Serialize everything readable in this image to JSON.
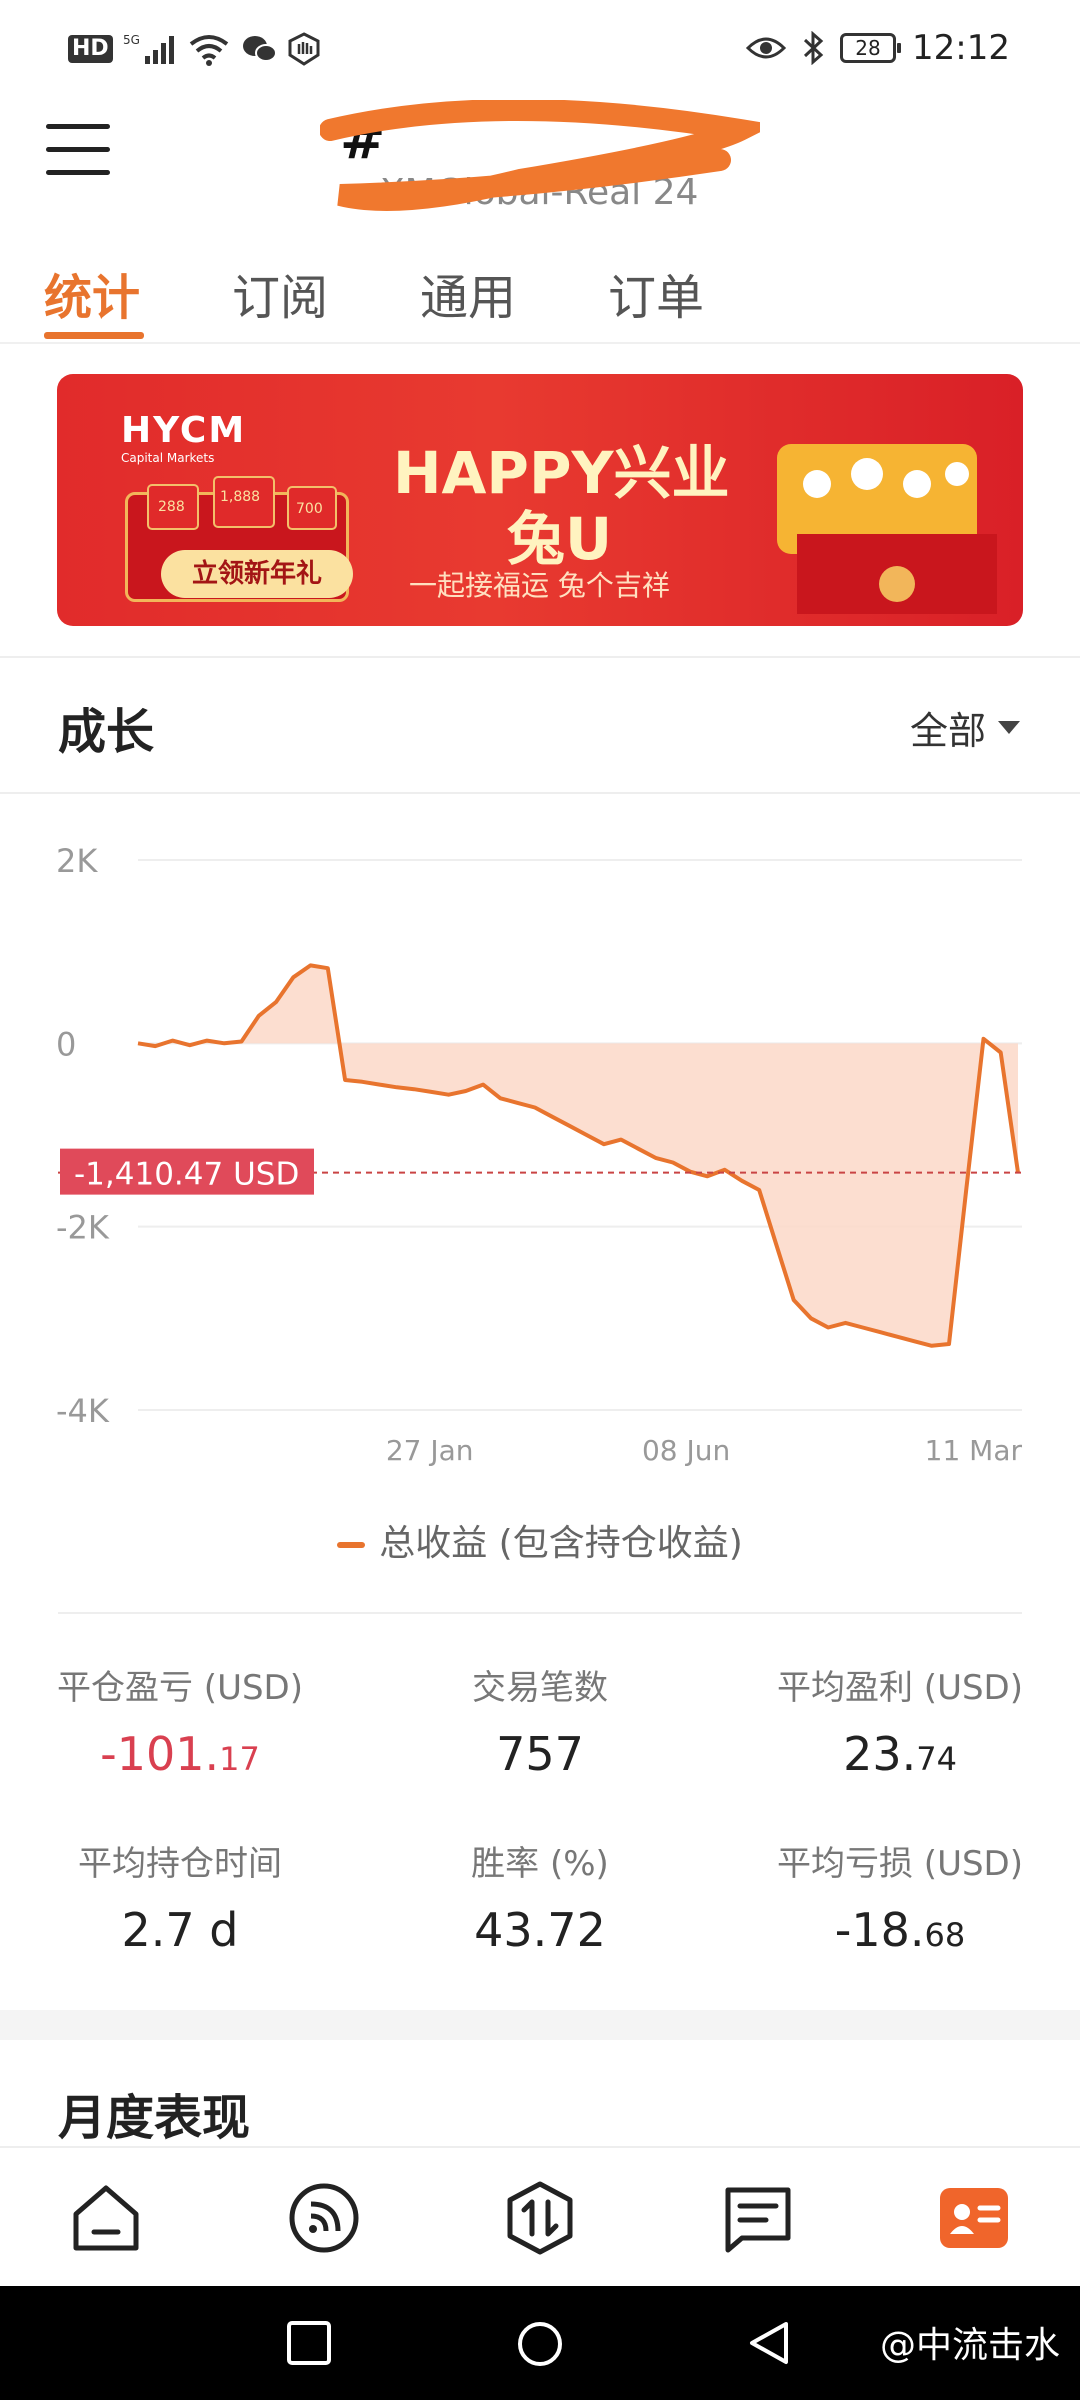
{
  "status_bar": {
    "left_badge": "HD",
    "signal_label": "5G",
    "wifi_label": "6",
    "battery": "28",
    "time": "12:12"
  },
  "header": {
    "title": "#",
    "subtitle": "XMGlobal-Real 24"
  },
  "tabs": [
    {
      "label": "统计",
      "active": true
    },
    {
      "label": "订阅",
      "active": false
    },
    {
      "label": "通用",
      "active": false
    },
    {
      "label": "订单",
      "active": false
    }
  ],
  "banner": {
    "logo": "HYCM",
    "logo_sub": "Capital Markets",
    "red_packet_amounts": [
      "288",
      "1,888",
      "700"
    ],
    "button_label": "立领新年礼",
    "headline": "HAPPY兴业",
    "headline2": "兔U",
    "slogan": "一起接福运 兔个吉祥"
  },
  "growth": {
    "title": "成长",
    "range_label": "全部"
  },
  "chart_data": {
    "type": "area",
    "y_ticks": [
      "2K",
      "0",
      "-2K",
      "-4K"
    ],
    "ylim": [
      -4000,
      2000
    ],
    "x_ticks": [
      "27 Jan",
      "08 Jun",
      "11 Mar"
    ],
    "current_value_label": "-1,410.47 USD",
    "current_value": -1410.47,
    "series": [
      {
        "name": "总收益 (包含持仓收益)",
        "color": "#e8742e",
        "values": [
          0,
          -30,
          30,
          -20,
          30,
          0,
          20,
          300,
          450,
          720,
          850,
          820,
          -400,
          -420,
          -450,
          -480,
          -500,
          -530,
          -560,
          -520,
          -450,
          -600,
          -650,
          -700,
          -800,
          -900,
          -1000,
          -1100,
          -1050,
          -1150,
          -1250,
          -1300,
          -1400,
          -1450,
          -1380,
          -1500,
          -1600,
          -2200,
          -2800,
          -3000,
          -3100,
          -3050,
          -3100,
          -3150,
          -3200,
          -3250,
          -3300,
          -3280,
          -1600,
          50,
          -100,
          -1410.47
        ]
      }
    ],
    "grid": true
  },
  "legend": {
    "label": "总收益 (包含持仓收益)"
  },
  "stats": [
    {
      "label": "平仓盈亏 (USD)",
      "int": "-101.",
      "dec": "17",
      "negative": true
    },
    {
      "label": "交易笔数",
      "int": "757",
      "dec": "",
      "negative": false
    },
    {
      "label": "平均盈利 (USD)",
      "int": "23.",
      "dec": "74",
      "negative": false
    },
    {
      "label": "平均持仓时间",
      "int": "2.7 d",
      "dec": "",
      "negative": false
    },
    {
      "label": "胜率 (%)",
      "int": "43.72",
      "dec": "",
      "negative": false
    },
    {
      "label": "平均亏损 (USD)",
      "int": "-18.",
      "dec": "68",
      "negative": false
    }
  ],
  "monthly": {
    "title": "月度表现"
  },
  "bottom_nav": [
    "home-icon",
    "feed-icon",
    "trade-icon",
    "messages-icon",
    "profile-card-icon"
  ],
  "watermark": "@中流击水",
  "colors": {
    "accent": "#e8742e",
    "negative": "#d94050",
    "banner_red": "#e12b2b"
  }
}
